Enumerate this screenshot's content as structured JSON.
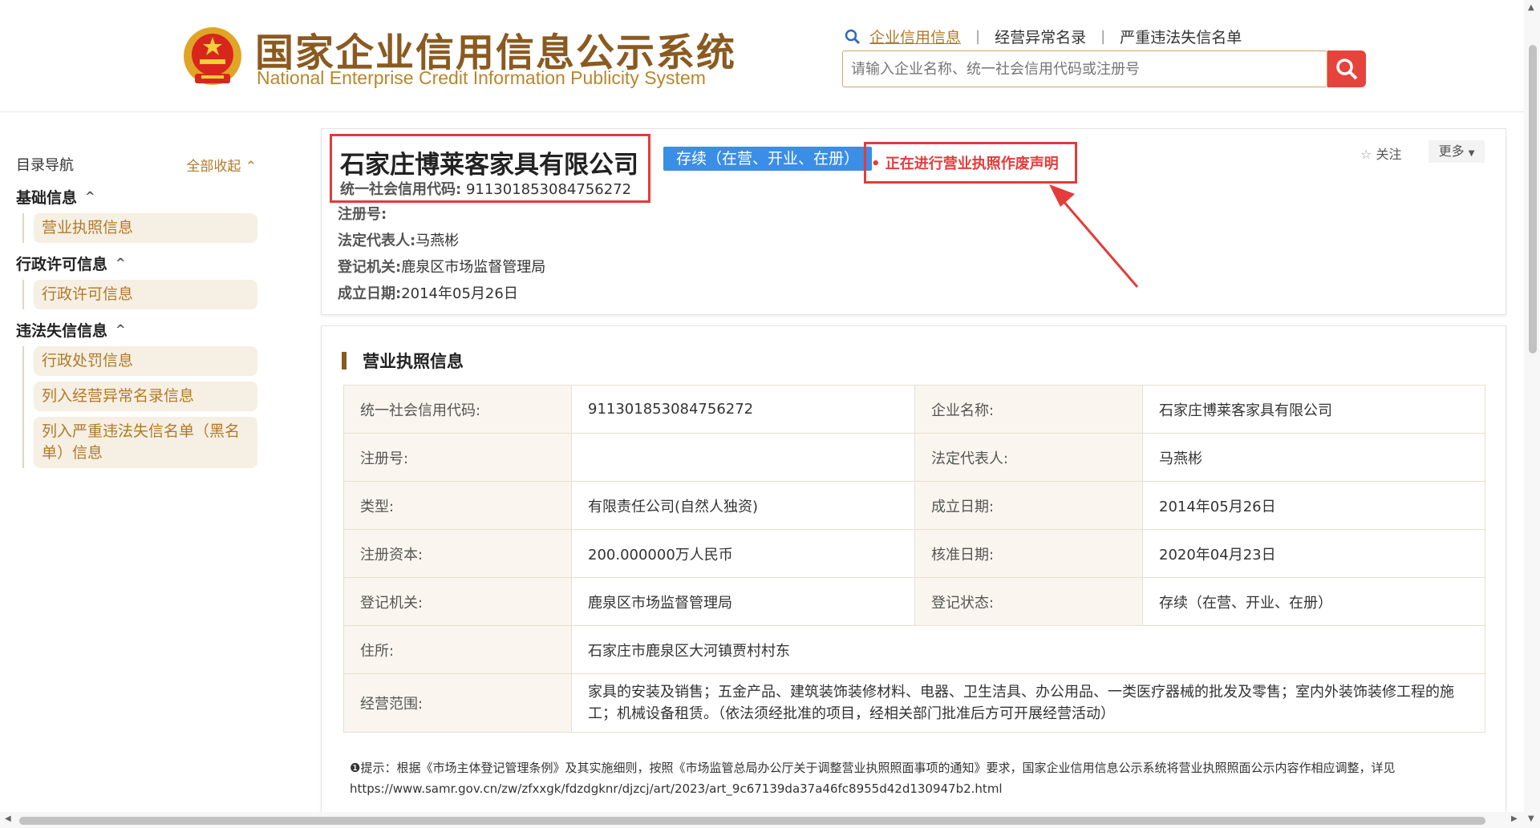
{
  "header": {
    "logo_cn": "国家企业信用信息公示系统",
    "logo_en": "National Enterprise Credit Information Publicity System",
    "nav": [
      "企业信用信息",
      "经营异常名录",
      "严重违法失信名单"
    ],
    "search_placeholder": "请输入企业名称、统一社会信用代码或注册号",
    "accent": "#b07a2a",
    "search_button_color": "#e7433d"
  },
  "sidebar": {
    "title": "目录导航",
    "collapse_all": "全部收起",
    "sections": [
      {
        "title": "基础信息",
        "items": [
          "营业执照信息"
        ]
      },
      {
        "title": "行政许可信息",
        "items": [
          "行政许可信息"
        ]
      },
      {
        "title": "违法失信信息",
        "items": [
          "行政处罚信息",
          "列入经营异常名录信息",
          "列入严重违法失信名单（黑名单）信息"
        ]
      }
    ]
  },
  "company": {
    "name": "石家庄博莱客家具有限公司",
    "credit_code_label": "统一社会信用代码:",
    "credit_code": "911301853084756272",
    "status_badge": "存续（在营、开业、在册）",
    "notice": "正在进行营业执照作废声明",
    "reg_no_label": "注册号:",
    "reg_no": "",
    "legal_rep_label": "法定代表人:",
    "legal_rep": "马燕彬",
    "authority_label": "登记机关:",
    "authority": "鹿泉区市场监督管理局",
    "founded_label": "成立日期:",
    "founded": "2014年05月26日",
    "follow_label": "关注",
    "more_label": "更多"
  },
  "license": {
    "title": "营业执照信息",
    "rows": [
      {
        "k1": "统一社会信用代码:",
        "v1": "911301853084756272",
        "k2": "企业名称:",
        "v2": "石家庄博莱客家具有限公司"
      },
      {
        "k1": "注册号:",
        "v1": "",
        "k2": "法定代表人:",
        "v2": "马燕彬"
      },
      {
        "k1": "类型:",
        "v1": "有限责任公司(自然人独资)",
        "k2": "成立日期:",
        "v2": "2014年05月26日"
      },
      {
        "k1": "注册资本:",
        "v1": "200.000000万人民币",
        "k2": "核准日期:",
        "v2": "2020年04月23日"
      },
      {
        "k1": "登记机关:",
        "v1": "鹿泉区市场监督管理局",
        "k2": "登记状态:",
        "v2": "存续（在营、开业、在册）"
      }
    ],
    "address_label": "住所:",
    "address": "石家庄市鹿泉区大河镇贾村村东",
    "scope_label": "经营范围:",
    "scope": "家具的安装及销售；五金产品、建筑装饰装修材料、电器、卫生洁具、办公用品、一类医疗器械的批发及零售；室内外装饰装修工程的施工；机械设备租赁。（依法须经批准的项目，经相关部门批准后方可开展经营活动）",
    "tip": "❶提示：根据《市场主体登记管理条例》及其实施细则，按照《市场监管总局办公厅关于调整营业执照照面事项的通知》要求，国家企业信用信息公示系统将营业执照照面公示内容作相应调整，详见https://www.samr.gov.cn/zw/zfxxgk/fdzdgknr/djzcj/art/2023/art_9c67139da37a46fc8955d42d130947b2.html"
  }
}
